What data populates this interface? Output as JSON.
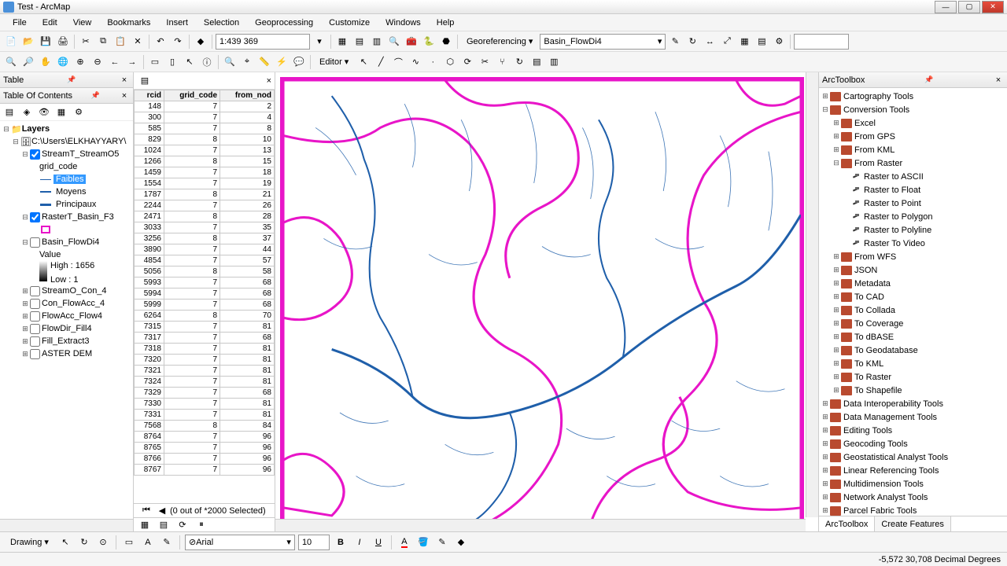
{
  "titlebar": {
    "title": "Test - ArcMap"
  },
  "menubar": [
    "File",
    "Edit",
    "View",
    "Bookmarks",
    "Insert",
    "Selection",
    "Geoprocessing",
    "Customize",
    "Windows",
    "Help"
  ],
  "scale": "1:439 369",
  "georef": {
    "label": "Georeferencing ▾",
    "layer": "Basin_FlowDi4"
  },
  "editor": "Editor ▾",
  "toc": {
    "header": "Table Of Contents",
    "root": "Layers",
    "dataframe": "C:\\Users\\ELKHAYYARY\\",
    "layers": [
      {
        "name": "StreamT_StreamO5",
        "checked": true,
        "expanded": true,
        "legendTitle": "grid_code",
        "classes": [
          {
            "label": "Faibles",
            "selected": true,
            "sym": "thin"
          },
          {
            "label": "Moyens",
            "sym": "med"
          },
          {
            "label": "Principaux",
            "sym": "thick"
          }
        ]
      },
      {
        "name": "RasterT_Basin_F3",
        "checked": true,
        "expanded": true,
        "polysym": true
      },
      {
        "name": "Basin_FlowDi4",
        "checked": false,
        "expanded": true,
        "valueLabel": "Value",
        "high": "High : 1656",
        "low": "Low : 1"
      },
      {
        "name": "StreamO_Con_4",
        "checked": false
      },
      {
        "name": "Con_FlowAcc_4",
        "checked": false
      },
      {
        "name": "FlowAcc_Flow4",
        "checked": false
      },
      {
        "name": "FlowDir_Fill4",
        "checked": false
      },
      {
        "name": "Fill_Extract3",
        "checked": false
      },
      {
        "name": "ASTER DEM",
        "checked": false
      }
    ]
  },
  "table": {
    "header": "Table",
    "columns": [
      "rcid",
      "grid_code",
      "from_nod"
    ],
    "rows": [
      [
        148,
        7,
        2
      ],
      [
        300,
        7,
        4
      ],
      [
        585,
        7,
        8
      ],
      [
        829,
        8,
        10
      ],
      [
        1024,
        7,
        13
      ],
      [
        1266,
        8,
        15
      ],
      [
        1459,
        7,
        18
      ],
      [
        1554,
        7,
        19
      ],
      [
        1787,
        8,
        21
      ],
      [
        2244,
        7,
        26
      ],
      [
        2471,
        8,
        28
      ],
      [
        3033,
        7,
        35
      ],
      [
        3256,
        8,
        37
      ],
      [
        3890,
        7,
        44
      ],
      [
        4854,
        7,
        57
      ],
      [
        5056,
        8,
        58
      ],
      [
        5993,
        7,
        68
      ],
      [
        5994,
        7,
        68
      ],
      [
        5999,
        7,
        68
      ],
      [
        6264,
        8,
        70
      ],
      [
        7315,
        7,
        81
      ],
      [
        7317,
        7,
        68
      ],
      [
        7318,
        7,
        81
      ],
      [
        7320,
        7,
        81
      ],
      [
        7321,
        7,
        81
      ],
      [
        7324,
        7,
        81
      ],
      [
        7329,
        7,
        68
      ],
      [
        7330,
        7,
        81
      ],
      [
        7331,
        7,
        81
      ],
      [
        7568,
        8,
        84
      ],
      [
        8764,
        7,
        96
      ],
      [
        8765,
        7,
        96
      ],
      [
        8766,
        7,
        96
      ],
      [
        8767,
        7,
        96
      ]
    ],
    "status": "(0 out of *2000 Selected)"
  },
  "arctoolbox": {
    "header": "ArcToolbox",
    "tree": [
      {
        "label": "Cartography Tools",
        "type": "toolbox"
      },
      {
        "label": "Conversion Tools",
        "type": "toolbox",
        "expanded": true,
        "children": [
          {
            "label": "Excel",
            "type": "toolbox"
          },
          {
            "label": "From GPS",
            "type": "toolbox"
          },
          {
            "label": "From KML",
            "type": "toolbox"
          },
          {
            "label": "From Raster",
            "type": "toolbox",
            "expanded": true,
            "children": [
              {
                "label": "Raster to ASCII",
                "type": "tool"
              },
              {
                "label": "Raster to Float",
                "type": "tool"
              },
              {
                "label": "Raster to Point",
                "type": "tool"
              },
              {
                "label": "Raster to Polygon",
                "type": "tool"
              },
              {
                "label": "Raster to Polyline",
                "type": "tool"
              },
              {
                "label": "Raster To Video",
                "type": "tool"
              }
            ]
          },
          {
            "label": "From WFS",
            "type": "toolbox"
          },
          {
            "label": "JSON",
            "type": "toolbox"
          },
          {
            "label": "Metadata",
            "type": "toolbox"
          },
          {
            "label": "To CAD",
            "type": "toolbox"
          },
          {
            "label": "To Collada",
            "type": "toolbox"
          },
          {
            "label": "To Coverage",
            "type": "toolbox"
          },
          {
            "label": "To dBASE",
            "type": "toolbox"
          },
          {
            "label": "To Geodatabase",
            "type": "toolbox"
          },
          {
            "label": "To KML",
            "type": "toolbox"
          },
          {
            "label": "To Raster",
            "type": "toolbox"
          },
          {
            "label": "To Shapefile",
            "type": "toolbox"
          }
        ]
      },
      {
        "label": "Data Interoperability Tools",
        "type": "toolbox"
      },
      {
        "label": "Data Management Tools",
        "type": "toolbox"
      },
      {
        "label": "Editing Tools",
        "type": "toolbox"
      },
      {
        "label": "Geocoding Tools",
        "type": "toolbox"
      },
      {
        "label": "Geostatistical Analyst Tools",
        "type": "toolbox"
      },
      {
        "label": "Linear Referencing Tools",
        "type": "toolbox"
      },
      {
        "label": "Multidimension Tools",
        "type": "toolbox"
      },
      {
        "label": "Network Analyst Tools",
        "type": "toolbox"
      },
      {
        "label": "Parcel Fabric Tools",
        "type": "toolbox"
      }
    ],
    "tabs": [
      "ArcToolbox",
      "Create Features"
    ]
  },
  "drawing": {
    "label": "Drawing ▾",
    "font": "Arial",
    "size": "10"
  },
  "status": "-5,572  30,708 Decimal Degrees",
  "colors": {
    "basin": "#e815c8",
    "stream": "#1f5faa"
  }
}
